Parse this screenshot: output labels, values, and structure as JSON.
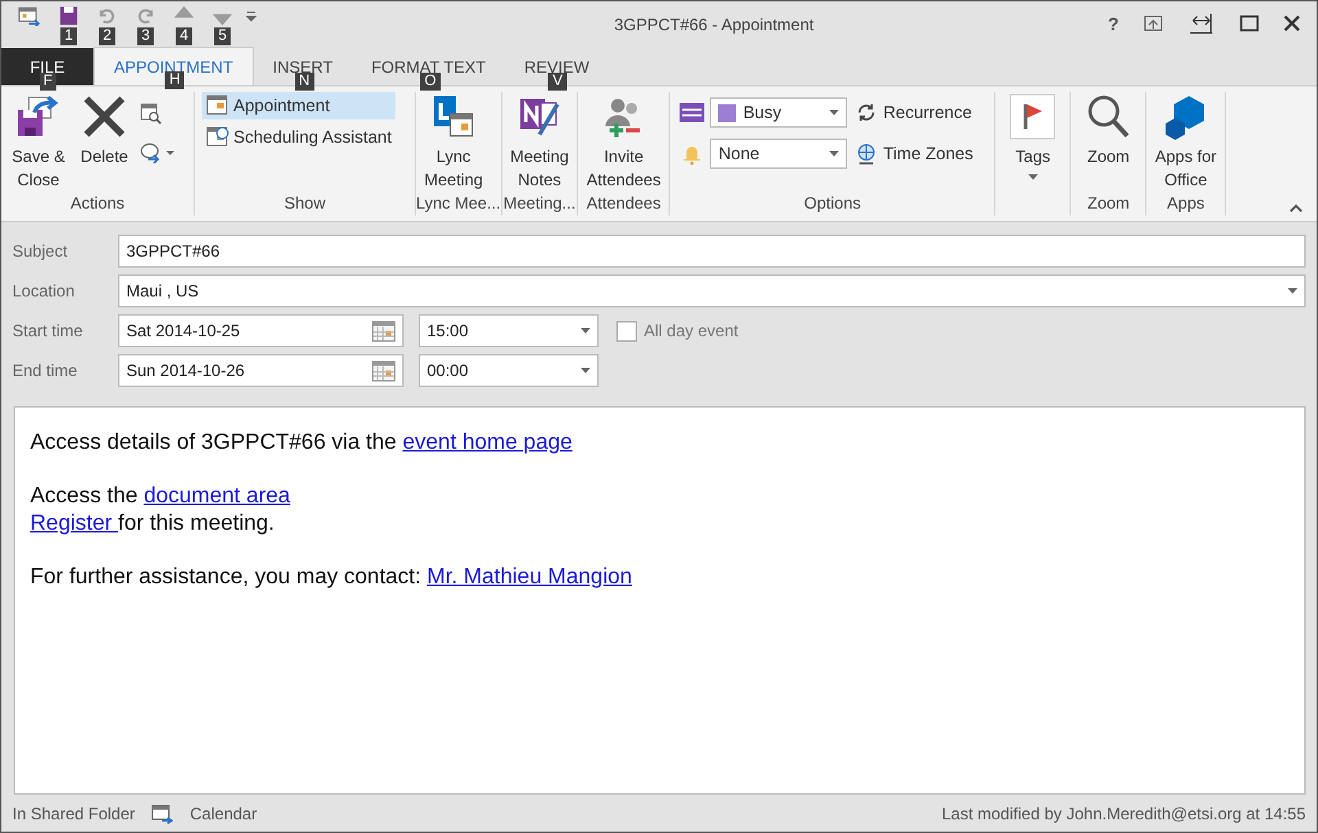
{
  "window": {
    "title": "3GPPCT#66 - Appointment",
    "help": "?"
  },
  "quick_access": [
    {
      "kind": "calendar",
      "disabled": false
    },
    {
      "kind": "save",
      "keytip": "1",
      "disabled": false
    },
    {
      "kind": "undo",
      "keytip": "2",
      "disabled": true
    },
    {
      "kind": "redo",
      "keytip": "3",
      "disabled": true
    },
    {
      "kind": "up",
      "keytip": "4",
      "disabled": true
    },
    {
      "kind": "down",
      "keytip": "5",
      "disabled": true
    }
  ],
  "tabs": [
    {
      "label": "FILE",
      "keytip": "F",
      "selected": false,
      "kind": "file"
    },
    {
      "label": "APPOINTMENT",
      "keytip": "H",
      "selected": true,
      "kind": "tab"
    },
    {
      "label": "INSERT",
      "keytip": "N",
      "selected": false,
      "kind": "tab"
    },
    {
      "label": "FORMAT TEXT",
      "keytip": "O",
      "selected": false,
      "kind": "tab"
    },
    {
      "label": "REVIEW",
      "keytip": "V",
      "selected": false,
      "kind": "tab"
    }
  ],
  "ribbon": {
    "groups": [
      {
        "name": "Actions",
        "kind": "actions",
        "buttons": [
          {
            "label": "Save &\nClose"
          },
          {
            "label": "Delete"
          }
        ]
      },
      {
        "name": "Show",
        "kind": "show",
        "buttons": [
          {
            "label": "Appointment",
            "selected": true
          },
          {
            "label": "Scheduling Assistant",
            "selected": false
          }
        ]
      },
      {
        "name": "Lync Mee...",
        "kind": "lync",
        "buttons": [
          {
            "label": "Lync\nMeeting"
          }
        ]
      },
      {
        "name": "Meeting...",
        "kind": "notes",
        "buttons": [
          {
            "label": "Meeting\nNotes"
          }
        ]
      },
      {
        "name": "Attendees",
        "kind": "attendees",
        "buttons": [
          {
            "label": "Invite\nAttendees"
          }
        ]
      },
      {
        "name": "Options",
        "kind": "options",
        "show_as": {
          "value": "Busy",
          "color": "#9b7fd4"
        },
        "reminder": {
          "value": "None"
        },
        "buttons": [
          {
            "label": "Recurrence"
          },
          {
            "label": "Time Zones"
          }
        ]
      },
      {
        "kind": "tags",
        "buttons": [
          {
            "label": "Tags"
          }
        ]
      },
      {
        "name": "Zoom",
        "kind": "zoom",
        "buttons": [
          {
            "label": "Zoom"
          }
        ]
      },
      {
        "name": "Apps",
        "kind": "apps",
        "buttons": [
          {
            "label": "Apps for\nOffice"
          }
        ]
      }
    ]
  },
  "form": {
    "subject": {
      "label": "Subject",
      "value": "3GPPCT#66"
    },
    "location": {
      "label": "Location",
      "value": "Maui , US"
    },
    "start": {
      "label": "Start time",
      "date": "Sat 2014-10-25",
      "time": "15:00"
    },
    "end": {
      "label": "End time",
      "date": "Sun 2014-10-26",
      "time": "00:00"
    },
    "all_day": {
      "label": "All day event",
      "checked": false
    }
  },
  "body": {
    "paragraphs": [
      {
        "lines": [
          [
            {
              "text": "Access details of 3GPPCT#66 via the ",
              "link": false
            },
            {
              "text": "event home page",
              "link": true
            }
          ]
        ]
      },
      {
        "lines": [
          [
            {
              "text": "Access the ",
              "link": false
            },
            {
              "text": "document area",
              "link": true
            }
          ],
          [
            {
              "text": "Register ",
              "link": true
            },
            {
              "text": "for this meeting.",
              "link": false
            }
          ]
        ]
      },
      {
        "lines": [
          [
            {
              "text": "For further assistance, you may contact: ",
              "link": false
            },
            {
              "text": "Mr. Mathieu Mangion",
              "link": true
            }
          ]
        ]
      }
    ]
  },
  "status_bar": {
    "folder": "In Shared Folder",
    "calendar": "Calendar",
    "modified": "Last modified by John.Meredith@etsi.org at 14:55"
  }
}
